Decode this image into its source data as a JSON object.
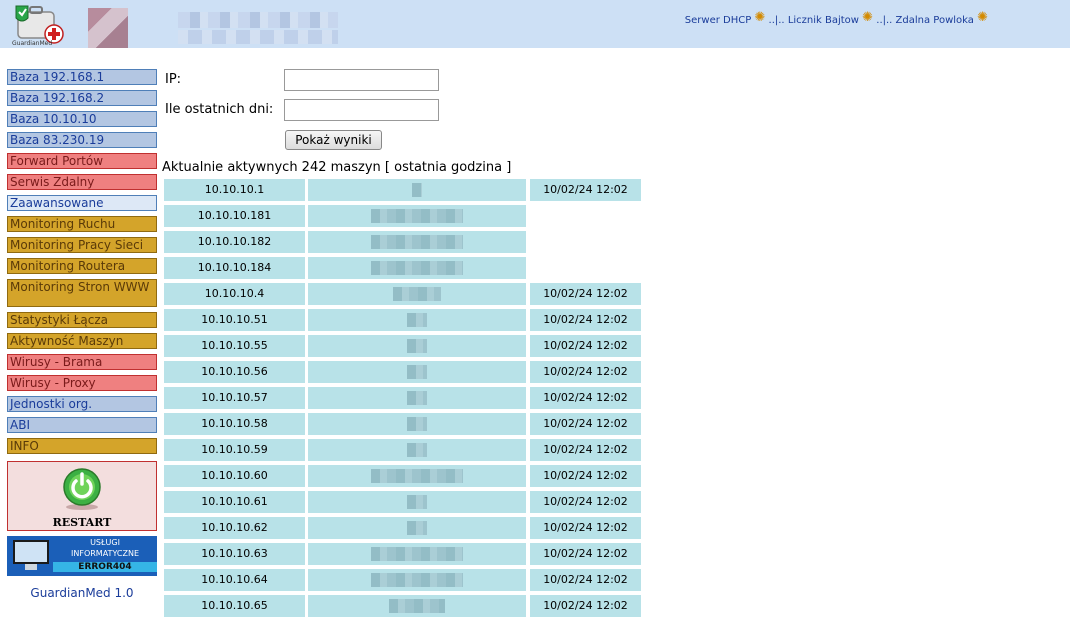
{
  "header": {
    "logo_caption": "GuardianMed",
    "links": [
      {
        "label": "Serwer DHCP"
      },
      {
        "label": "Licznik Bajtow"
      },
      {
        "label": "Zdalna Powloka"
      }
    ],
    "separator": "..|.."
  },
  "sidebar": {
    "items": [
      {
        "label": "Baza 192.168.1",
        "color": "#b3c6e2"
      },
      {
        "label": "Baza 192.168.2",
        "color": "#b3c6e2"
      },
      {
        "label": "Baza 10.10.10",
        "color": "#b3c6e2"
      },
      {
        "label": "Baza 83.230.19",
        "color": "#b3c6e2"
      },
      {
        "label": "Forward Portów",
        "color": "#ef8080"
      },
      {
        "label": "Serwis Zdalny",
        "color": "#ef8080"
      },
      {
        "label": "Zaawansowane",
        "color": "#dde8f6"
      },
      {
        "label": "Monitoring Ruchu",
        "color": "#d4a42a"
      },
      {
        "label": "Monitoring Pracy Sieci",
        "color": "#d4a42a"
      },
      {
        "label": "Monitoring Routera",
        "color": "#d4a42a"
      },
      {
        "label": "Monitoring Stron WWW",
        "color": "#d4a42a"
      },
      {
        "label": "Statystyki Łącza",
        "color": "#d4a42a"
      },
      {
        "label": "Aktywność Maszyn",
        "color": "#d4a42a"
      },
      {
        "label": "Wirusy - Brama",
        "color": "#ef8080"
      },
      {
        "label": "Wirusy - Proxy",
        "color": "#ef8080"
      },
      {
        "label": "Jednostki org.",
        "color": "#b3c6e2"
      },
      {
        "label": "ABI",
        "color": "#b3c6e2"
      },
      {
        "label": "INFO",
        "color": "#d4a42a"
      }
    ],
    "restart_label": "RESTART",
    "banner": {
      "line1": "USŁUGI",
      "line2": "INFORMATYCZNE",
      "line3": "ERROR404"
    },
    "version": "GuardianMed 1.0"
  },
  "form": {
    "ip_label": "IP:",
    "ip_value": "",
    "days_label": "Ile ostatnich dni:",
    "days_value": "",
    "submit_label": "Pokaż wyniki"
  },
  "active": {
    "heading": "Aktualnie aktywnych 242 maszyn [ ostatnia godzina ]",
    "rows": [
      {
        "ip": "10.10.10.1",
        "date": "10/02/24 12:02"
      },
      {
        "ip": "10.10.10.181",
        "date": ""
      },
      {
        "ip": "10.10.10.182",
        "date": ""
      },
      {
        "ip": "10.10.10.184",
        "date": ""
      },
      {
        "ip": "10.10.10.4",
        "date": "10/02/24 12:02"
      },
      {
        "ip": "10.10.10.51",
        "date": "10/02/24 12:02"
      },
      {
        "ip": "10.10.10.55",
        "date": "10/02/24 12:02"
      },
      {
        "ip": "10.10.10.56",
        "date": "10/02/24 12:02"
      },
      {
        "ip": "10.10.10.57",
        "date": "10/02/24 12:02"
      },
      {
        "ip": "10.10.10.58",
        "date": "10/02/24 12:02"
      },
      {
        "ip": "10.10.10.59",
        "date": "10/02/24 12:02"
      },
      {
        "ip": "10.10.10.60",
        "date": "10/02/24 12:02"
      },
      {
        "ip": "10.10.10.61",
        "date": "10/02/24 12:02"
      },
      {
        "ip": "10.10.10.62",
        "date": "10/02/24 12:02"
      },
      {
        "ip": "10.10.10.63",
        "date": "10/02/24 12:02"
      },
      {
        "ip": "10.10.10.64",
        "date": "10/02/24 12:02"
      },
      {
        "ip": "10.10.10.65",
        "date": "10/02/24 12:02"
      }
    ]
  }
}
